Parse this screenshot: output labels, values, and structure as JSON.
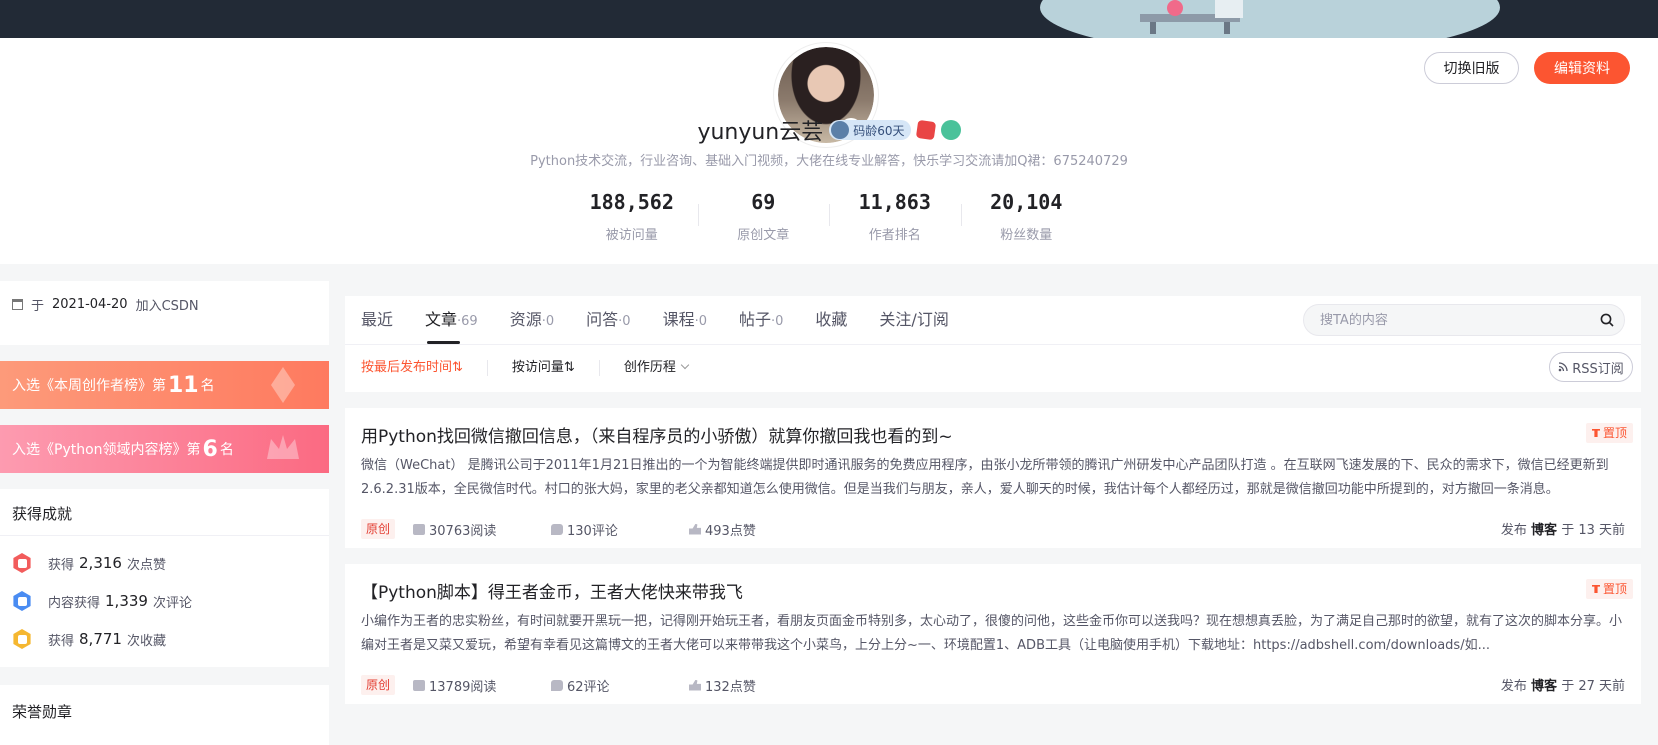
{
  "profile": {
    "name": "yunyun云芸",
    "code_age": "码龄60天",
    "bio": "Python技术交流，行业咨询、基础入门视频，大佬在线专业解答，快乐学习交流请加Q裙：675240729",
    "switch_old_label": "切换旧版",
    "edit_label": "编辑资料",
    "stats": [
      {
        "value": "188,562",
        "label": "被访问量"
      },
      {
        "value": "69",
        "label": "原创文章"
      },
      {
        "value": "11,863",
        "label": "作者排名"
      },
      {
        "value": "20,104",
        "label": "粉丝数量"
      }
    ]
  },
  "sidebar": {
    "join": {
      "prefix": "于",
      "date": "2021-04-20",
      "suffix": "加入CSDN"
    },
    "rank1": {
      "text": "入选《本周创作者榜》第",
      "num": "11",
      "unit": "名"
    },
    "rank2": {
      "text": "入选《Python领域内容榜》第",
      "num": "6",
      "unit": "名"
    },
    "achievements": {
      "title": "获得成就",
      "items": [
        {
          "prefix": "获得",
          "value": "2,316",
          "suffix": "次点赞",
          "color": "#f25c5c"
        },
        {
          "prefix": "内容获得",
          "value": "1,339",
          "suffix": "次评论",
          "color": "#4a8cf2"
        },
        {
          "prefix": "获得",
          "value": "8,771",
          "suffix": "次收藏",
          "color": "#f5b731"
        }
      ]
    },
    "honor_title": "荣誉勋章"
  },
  "nav": {
    "tabs": [
      {
        "label": "最近",
        "count": ""
      },
      {
        "label": "文章",
        "count": "·69"
      },
      {
        "label": "资源",
        "count": "·0"
      },
      {
        "label": "问答",
        "count": "·0"
      },
      {
        "label": "课程",
        "count": "·0"
      },
      {
        "label": "帖子",
        "count": "·0"
      },
      {
        "label": "收藏",
        "count": ""
      },
      {
        "label": "关注/订阅",
        "count": ""
      }
    ],
    "search_placeholder": "搜TA的内容",
    "sorts": [
      "按最后发布时间⇅",
      "按访问量⇅",
      "创作历程"
    ],
    "rss_label": "RSS订阅"
  },
  "articles": [
    {
      "title": "用Python找回微信撤回信息，（来自程序员的小骄傲）就算你撤回我也看的到~",
      "pin": "置顶",
      "desc": "微信（WeChat） 是腾讯公司于2011年1月21日推出的一个为智能终端提供即时通讯服务的免费应用程序，由张小龙所带领的腾讯广州研发中心产品团队打造 。在互联网飞速发展的下、民众的需求下，微信已经更新到2.6.2.31版本，全民微信时代。村口的张大妈，家里的老父亲都知道怎么使用微信。但是当我们与朋友，亲人，爱人聊天的时候，我估计每个人都经历过，那就是微信撤回功能中所提到的，对方撤回一条消息。",
      "tag": "原创",
      "reads": "30763阅读",
      "comments": "130评论",
      "likes": "493点赞",
      "pub_prefix": "发布",
      "pub_type": "博客",
      "pub_time": "于 13 天前"
    },
    {
      "title": "【Python脚本】得王者金币，王者大佬快来带我飞",
      "pin": "置顶",
      "desc": "小编作为王者的忠实粉丝，有时间就要开黑玩一把，记得刚开始玩王者，看朋友页面金币特别多，太心动了，很傻的问他，这些金币你可以送我吗？现在想想真丢脸，为了满足自己那时的欲望，就有了这次的脚本分享。小编对王者是又菜又爱玩，希望有幸看见这篇博文的王者大佬可以来带带我这个小菜鸟，上分上分~一、环境配置1、ADB工具（让电脑使用手机）下载地址：https://adbshell.com/downloads/如...",
      "tag": "原创",
      "reads": "13789阅读",
      "comments": "62评论",
      "likes": "132点赞",
      "pub_prefix": "发布",
      "pub_type": "博客",
      "pub_time": "于 27 天前"
    }
  ]
}
